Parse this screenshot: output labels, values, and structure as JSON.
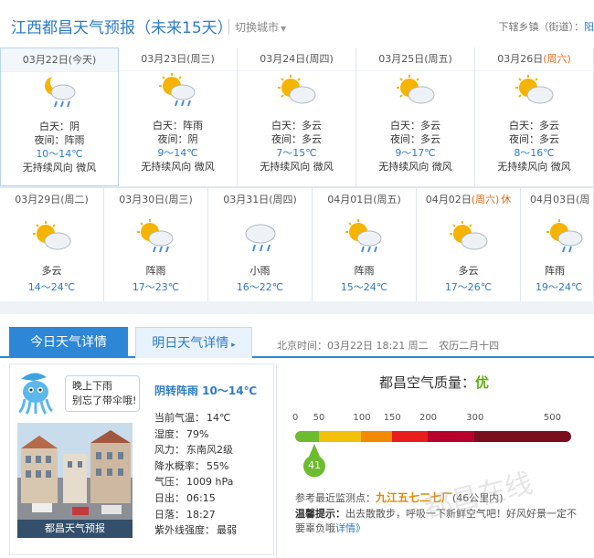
{
  "header": {
    "title": "江西都昌天气预报（未来15天）",
    "switch_city": "切换城市",
    "download_label": "下辖乡镇（街道）：",
    "download_link": "阳"
  },
  "forecast_row1": [
    {
      "date": "03月22日",
      "weekday": "(今天)",
      "weekend": false,
      "day": "白天：阴",
      "night": "夜间：阵雨",
      "temp": "10～14℃",
      "wind": "无持续风向 微风",
      "icon": "moon-cloud-rain-icon"
    },
    {
      "date": "03月23日",
      "weekday": "(周三)",
      "weekend": false,
      "day": "白天：阵雨",
      "night": "夜间：阴",
      "temp": "9～14℃",
      "wind": "无持续风向 微风",
      "icon": "sun-cloud-rain-icon"
    },
    {
      "date": "03月24日",
      "weekday": "(周四)",
      "weekend": false,
      "day": "白天：多云",
      "night": "夜间：多云",
      "temp": "7～15℃",
      "wind": "无持续风向 微风",
      "icon": "sun-cloud-icon"
    },
    {
      "date": "03月25日",
      "weekday": "(周五)",
      "weekend": false,
      "day": "白天：多云",
      "night": "夜间：多云",
      "temp": "9～17℃",
      "wind": "无持续风向 微风",
      "icon": "sun-cloud-icon"
    },
    {
      "date": "03月26日",
      "weekday": "(周六)",
      "weekend": true,
      "day": "白天：多云",
      "night": "夜间：多云",
      "temp": "8～16℃",
      "wind": "无持续风向 微风",
      "icon": "sun-cloud-icon"
    }
  ],
  "forecast_row2": [
    {
      "date": "03月29日",
      "weekday": "(周二)",
      "weekend": false,
      "holiday": "",
      "cond": "多云",
      "temp": "14～24℃",
      "icon": "sun-cloud-icon"
    },
    {
      "date": "03月30日",
      "weekday": "(周三)",
      "weekend": false,
      "holiday": "",
      "cond": "阵雨",
      "temp": "17～23℃",
      "icon": "sun-cloud-rain-icon"
    },
    {
      "date": "03月31日",
      "weekday": "(周四)",
      "weekend": false,
      "holiday": "",
      "cond": "小雨",
      "temp": "16～22℃",
      "icon": "cloud-rain-icon"
    },
    {
      "date": "04月01日",
      "weekday": "(周五)",
      "weekend": false,
      "holiday": "",
      "cond": "阵雨",
      "temp": "15～24℃",
      "icon": "sun-cloud-rain-icon"
    },
    {
      "date": "04月02日",
      "weekday": "(周六)",
      "weekend": true,
      "holiday": "休",
      "cond": "多云",
      "temp": "17～26℃",
      "icon": "sun-cloud-icon"
    },
    {
      "date": "04月03日",
      "weekday": "(周",
      "weekend": false,
      "holiday": "",
      "cond": "阵雨",
      "temp": "19～24℃",
      "icon": "sun-cloud-rain-icon"
    }
  ],
  "tabs": {
    "today": "今日天气详情",
    "tomorrow": "明日天气详情"
  },
  "timebar": {
    "beijing_time": "北京时间：03月22日 18:21 周二",
    "lunar": "农历二月十四"
  },
  "detail": {
    "bubble_line1": "晚上下雨",
    "bubble_line2": "别忘了带伞哦!",
    "condition": "阴转阵雨  10～14℃",
    "photo_caption": "都昌天气预报",
    "stats": [
      {
        "label": "当前气温：",
        "value": "14℃"
      },
      {
        "label": "湿度：",
        "value": "79%"
      },
      {
        "label": "风力：",
        "value": "东南风2级"
      },
      {
        "label": "降水概率：",
        "value": "55%"
      },
      {
        "label": "气压：",
        "value": "1009 hPa"
      },
      {
        "label": "日出：",
        "value": "06:15"
      },
      {
        "label": "日落：",
        "value": "18:27"
      },
      {
        "label": "紫外线强度：",
        "value": "最弱"
      }
    ]
  },
  "air_quality": {
    "title": "都昌空气质量：",
    "level": "优",
    "aqi": 41,
    "scale_labels": [
      "0",
      "50",
      "100",
      "150",
      "200",
      "300",
      "500"
    ],
    "colors": [
      "#6dbb2f",
      "#f2c00a",
      "#f28a00",
      "#ea1d1d",
      "#b8002d",
      "#7a0e1e"
    ],
    "station_label": "参考最近监测点：",
    "station": "九江五七二七厂",
    "station_distance": "(46公里内)",
    "tip_label": "温馨提示：",
    "tip": "出去散散步，呼吸一下新鲜空气吧！好风好景一定不要辜负哦",
    "more": "详情》"
  },
  "watermark": "都昌在线"
}
